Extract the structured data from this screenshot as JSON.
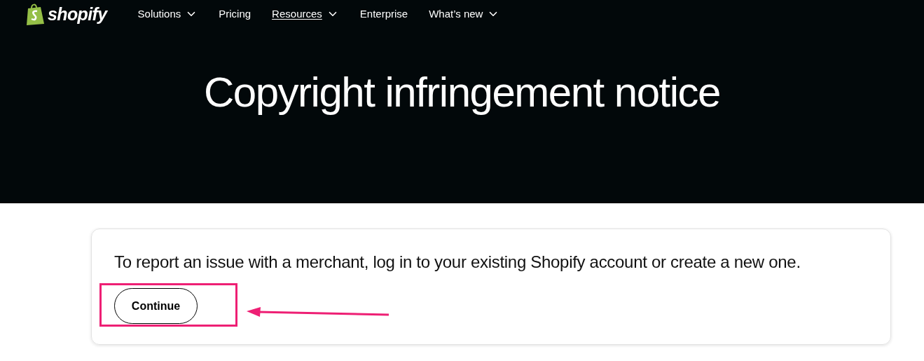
{
  "header": {
    "logo_text": "shopify",
    "nav": [
      {
        "label": "Solutions",
        "has_menu": true,
        "selected": false
      },
      {
        "label": "Pricing",
        "has_menu": false,
        "selected": false
      },
      {
        "label": "Resources",
        "has_menu": true,
        "selected": true
      },
      {
        "label": "Enterprise",
        "has_menu": false,
        "selected": false
      },
      {
        "label": "What’s new",
        "has_menu": true,
        "selected": false
      }
    ],
    "title": "Copyright infringement notice"
  },
  "card": {
    "message": "To report an issue with a merchant, log in to your existing Shopify account or create a new one.",
    "button": "Continue"
  },
  "annotation": {
    "highlight": true,
    "arrow": true,
    "color": "#ee1f74"
  }
}
